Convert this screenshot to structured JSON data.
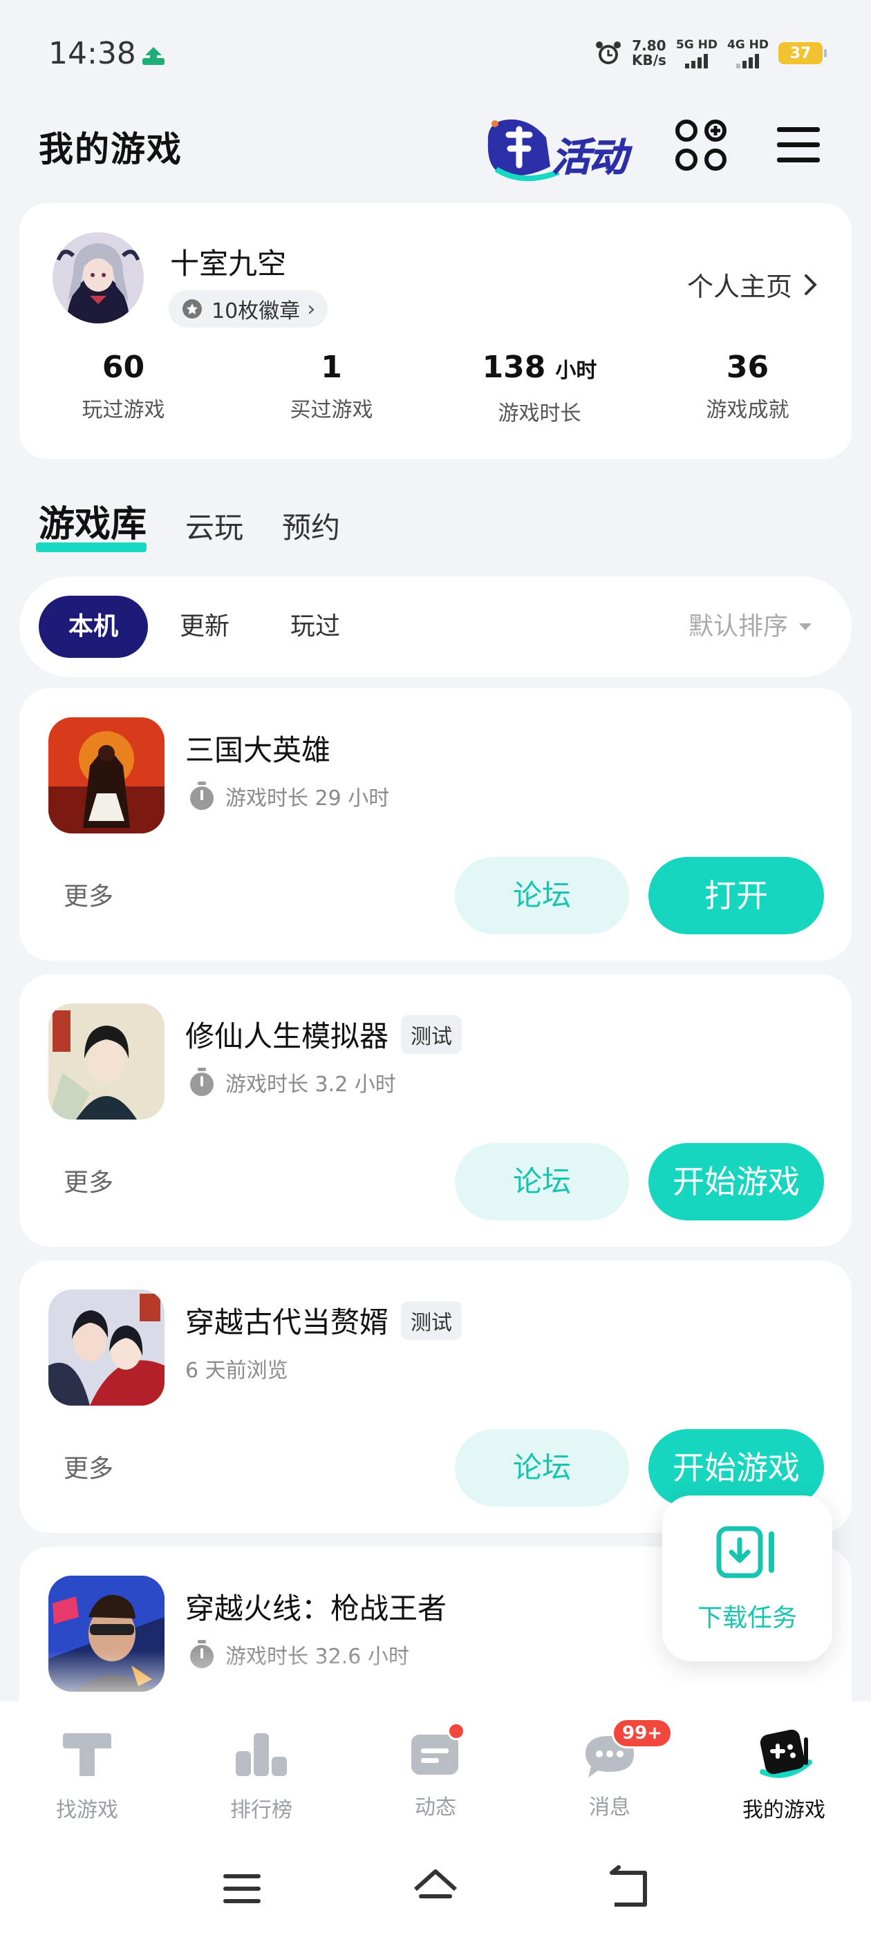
{
  "status_bar": {
    "time": "14:38",
    "net_speed_value": "7.80",
    "net_speed_unit": "KB/s",
    "sim1_label": "5G HD",
    "sim2_label": "4G HD",
    "battery": "37"
  },
  "header": {
    "title": "我的游戏",
    "activity_label": "活动"
  },
  "profile": {
    "name": "十室九空",
    "badge_label": "10枚徽章",
    "home_link": "个人主页",
    "stats": [
      {
        "value": "60",
        "unit": "",
        "label": "玩过游戏"
      },
      {
        "value": "1",
        "unit": "",
        "label": "买过游戏"
      },
      {
        "value": "138",
        "unit": "小时",
        "label": "游戏时长"
      },
      {
        "value": "36",
        "unit": "",
        "label": "游戏成就"
      }
    ]
  },
  "main_tabs": [
    "游戏库",
    "云玩",
    "预约"
  ],
  "filter": {
    "chips": [
      "本机",
      "更新",
      "玩过"
    ],
    "sort_label": "默认排序"
  },
  "games": [
    {
      "title": "三国大英雄",
      "tag": "",
      "meta": "游戏时长 29 小时",
      "more": "更多",
      "forum": "论坛",
      "action": "打开"
    },
    {
      "title": "修仙人生模拟器",
      "tag": "测试",
      "meta": "游戏时长 3.2 小时",
      "more": "更多",
      "forum": "论坛",
      "action": "开始游戏"
    },
    {
      "title": "穿越古代当赘婿",
      "tag": "测试",
      "meta": "6 天前浏览",
      "more": "更多",
      "forum": "论坛",
      "action": "开始游戏"
    },
    {
      "title": "穿越火线：枪战王者",
      "tag": "",
      "meta": "游戏时长 32.6 小时"
    }
  ],
  "download_fab": {
    "label": "下载任务"
  },
  "bottom_nav": {
    "items": [
      "找游戏",
      "排行榜",
      "动态",
      "消息",
      "我的游戏"
    ],
    "message_badge": "99+"
  },
  "colors": {
    "accent": "#16d6c0",
    "dark_chip": "#1e1b78",
    "badge_red": "#f2473d"
  }
}
